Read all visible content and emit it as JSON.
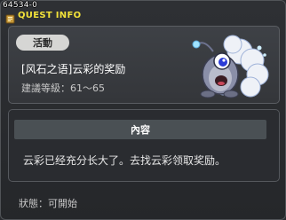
{
  "window": {
    "quest_id": "64534-0",
    "title": "QUEST INFO"
  },
  "quest": {
    "badge": "活動",
    "name": "[风石之语]云彩的奖励",
    "level": "建議等級：61～65"
  },
  "content": {
    "header": "內容",
    "body": "云彩已经充分长大了。去找云彩领取奖励。"
  },
  "status": {
    "text": "狀態：可開始"
  },
  "colors": {
    "title": "#f2e23a",
    "panel": "#3e4146",
    "badge_bg": "#d6d6d4"
  },
  "icons": {
    "title": "quest-book-icon",
    "creature": "cloud-creature-sprite"
  }
}
